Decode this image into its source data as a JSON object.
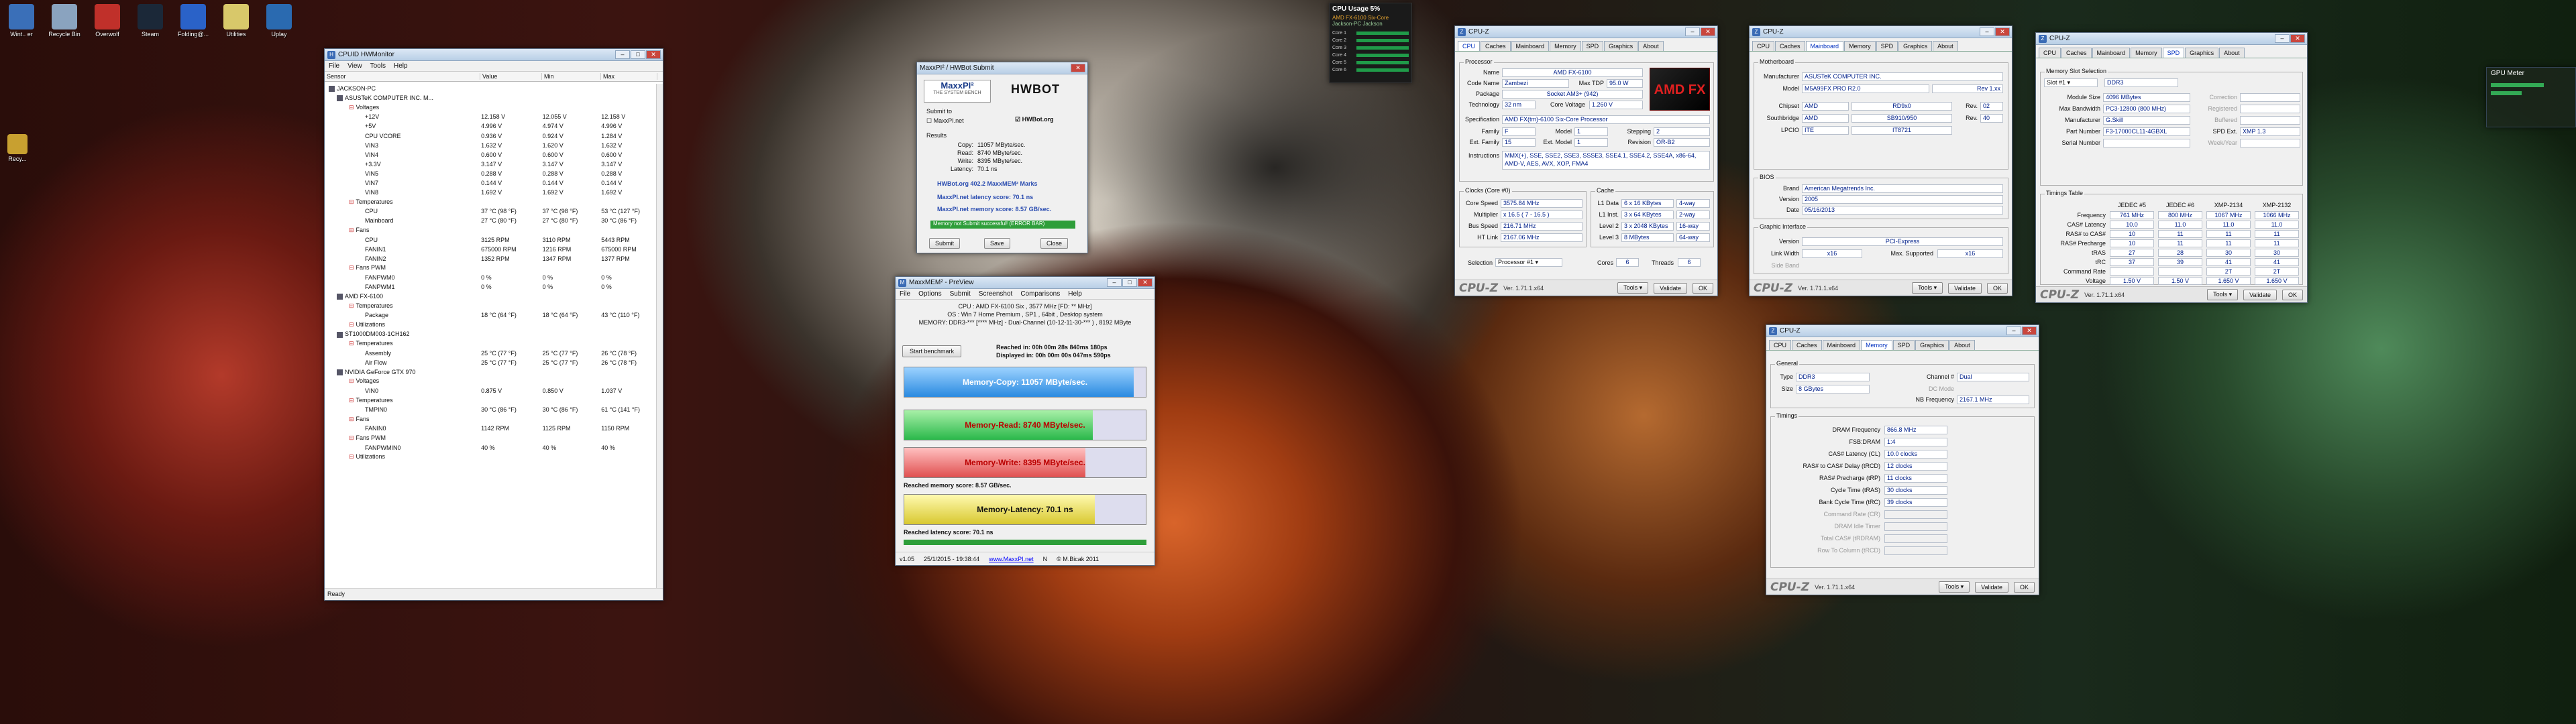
{
  "desktop_icons": [
    {
      "label": "Wint.. er",
      "color": "#3a6fb8"
    },
    {
      "label": "Recycle Bin",
      "color": "#8aa3bf"
    },
    {
      "label": "Overwolf",
      "color": "#c0302a"
    },
    {
      "label": "Steam",
      "color": "#1b2838"
    },
    {
      "label": "Folding@...",
      "color": "#2a62c8"
    },
    {
      "label": "Utilities",
      "color": "#d8c86a"
    },
    {
      "label": "Uplay",
      "color": "#2a6ab0"
    }
  ],
  "right_icon": {
    "label": "Recy..."
  },
  "hwmon": {
    "title": "CPUID HWMonitor",
    "menu": [
      "File",
      "View",
      "Tools",
      "Help"
    ],
    "cols": [
      "Sensor",
      "Value",
      "Min",
      "Max"
    ],
    "status": "Ready",
    "rows": [
      [
        "JACKSON-PC",
        "",
        "",
        ""
      ],
      [
        "ASUSTeK COMPUTER INC. M...",
        "",
        "",
        ""
      ],
      [
        "Voltages",
        "",
        "",
        ""
      ],
      [
        "+12V",
        "12.158 V",
        "12.055 V",
        "12.158 V"
      ],
      [
        "+5V",
        "4.996 V",
        "4.974 V",
        "4.996 V"
      ],
      [
        "CPU VCORE",
        "0.936 V",
        "0.924 V",
        "1.284 V"
      ],
      [
        "VIN3",
        "1.632 V",
        "1.620 V",
        "1.632 V"
      ],
      [
        "VIN4",
        "0.600 V",
        "0.600 V",
        "0.600 V"
      ],
      [
        "+3.3V",
        "3.147 V",
        "3.147 V",
        "3.147 V"
      ],
      [
        "VIN5",
        "0.288 V",
        "0.288 V",
        "0.288 V"
      ],
      [
        "VIN7",
        "0.144 V",
        "0.144 V",
        "0.144 V"
      ],
      [
        "VIN8",
        "1.692 V",
        "1.692 V",
        "1.692 V"
      ],
      [
        "Temperatures",
        "",
        "",
        ""
      ],
      [
        "CPU",
        "37 °C (98 °F)",
        "37 °C (98 °F)",
        "53 °C (127 °F)"
      ],
      [
        "Mainboard",
        "27 °C (80 °F)",
        "27 °C (80 °F)",
        "30 °C (86 °F)"
      ],
      [
        "Fans",
        "",
        "",
        ""
      ],
      [
        "CPU",
        "3125 RPM",
        "3110 RPM",
        "5443 RPM"
      ],
      [
        "FANIN1",
        "675000 RPM",
        "1216 RPM",
        "675000 RPM"
      ],
      [
        "FANIN2",
        "1352 RPM",
        "1347 RPM",
        "1377 RPM"
      ],
      [
        "Fans PWM",
        "",
        "",
        ""
      ],
      [
        "FANPWM0",
        "0 %",
        "0 %",
        "0 %"
      ],
      [
        "FANPWM1",
        "0 %",
        "0 %",
        "0 %"
      ],
      [
        "AMD FX-6100",
        "",
        "",
        ""
      ],
      [
        "Temperatures",
        "",
        "",
        ""
      ],
      [
        "Package",
        "18 °C (64 °F)",
        "18 °C (64 °F)",
        "43 °C (110 °F)"
      ],
      [
        "Utilizations",
        "",
        "",
        ""
      ],
      [
        "ST1000DM003-1CH162",
        "",
        "",
        ""
      ],
      [
        "Temperatures",
        "",
        "",
        ""
      ],
      [
        "Assembly",
        "25 °C (77 °F)",
        "25 °C (77 °F)",
        "26 °C (78 °F)"
      ],
      [
        "Air Flow",
        "25 °C (77 °F)",
        "25 °C (77 °F)",
        "26 °C (78 °F)"
      ],
      [
        "NVIDIA GeForce GTX 970",
        "",
        "",
        ""
      ],
      [
        "Voltages",
        "",
        "",
        ""
      ],
      [
        "VIN0",
        "0.875 V",
        "0.850 V",
        "1.037 V"
      ],
      [
        "Temperatures",
        "",
        "",
        ""
      ],
      [
        "TMPIN0",
        "30 °C (86 °F)",
        "30 °C (86 °F)",
        "61 °C (141 °F)"
      ],
      [
        "Fans",
        "",
        "",
        ""
      ],
      [
        "FANIN0",
        "1142 RPM",
        "1125 RPM",
        "1150 RPM"
      ],
      [
        "Fans PWM",
        "",
        "",
        ""
      ],
      [
        "FANPWMIN0",
        "40 %",
        "40 %",
        "40 %"
      ],
      [
        "Utilizations",
        "",
        "",
        ""
      ]
    ]
  },
  "submit": {
    "title": "MaxxPI² / HWBot Submit",
    "brand": "MaxxPI²",
    "brand_sub": "THE SYSTEM BENCH",
    "submit_to": "Submit to",
    "maxxpi_net": "MaxxPI.net",
    "hwbot": "HWBOT",
    "hwbot_org": "HWBot.org",
    "results": "Results",
    "lines": [
      [
        "Copy:",
        "11057 MByte/sec."
      ],
      [
        "Read:",
        "8740 MByte/sec."
      ],
      [
        "Write:",
        "8395 MByte/sec."
      ],
      [
        "Latency:",
        "70.1 ns"
      ]
    ],
    "marks": "HWBot.org 402.2 MaxxMEM² Marks",
    "latency": "MaxxPI.net latency score: 70.1 ns",
    "memory": "MaxxPI.net memory score:  8.57 GB/sec.",
    "status": "Memory not Submit successful!  (ERROR BAR)",
    "btn_submit": "Submit",
    "btn_save": "Save",
    "btn_close": "Close"
  },
  "maxxmem": {
    "title": "MaxxMEM² - PreView",
    "menu": [
      "File",
      "Options",
      "Submit",
      "Screenshot",
      "Comparisons",
      "Help"
    ],
    "cpu": "CPU : AMD FX-6100 Six , 3577 MHz  [FD: ** MHz]",
    "os": "OS : Win 7 Home Premium , SP1 , 64bit , Desktop system",
    "mem": "MEMORY: DDR3-*** [**** MHz] - Dual-Channel (10-12-11-30-*** ) , 8192 MByte",
    "start": "Start benchmark",
    "reached": "Reached in: 00h 00m 28s 840ms 180ps",
    "displayed": "Displayed in: 00h 00m 00s 047ms 590ps",
    "copy": "Memory-Copy: 11057 MByte/sec.",
    "read": "Memory-Read: 8740 MByte/sec.",
    "write": "Memory-Write: 8395 MByte/sec.",
    "mem_score": "Reached memory score: 8.57 GB/sec.",
    "latency": "Memory-Latency: 70.1 ns",
    "lat_score": "Reached latency score: 70.1 ns",
    "footer_ver": "v1.05",
    "footer_date": "25/1/2015 - 19:38:44",
    "footer_url": "www.MaxxPI.net",
    "footer_n": "N",
    "footer_copy": "© M.Bicak 2011",
    "fill": {
      "copy": 0.95,
      "read": 0.78,
      "write": 0.75,
      "latency": 0.79
    }
  },
  "cpuz_ver": "Ver. 1.71.1.x64",
  "tools": "Tools",
  "validate": "Validate",
  "ok": "OK",
  "cpuz1": {
    "title": "CPU-Z",
    "tabs": [
      "CPU",
      "Caches",
      "Mainboard",
      "Memory",
      "SPD",
      "Graphics",
      "About"
    ],
    "proc": "Processor",
    "fields": [
      [
        "Name",
        "AMD FX-6100"
      ],
      [
        "Code Name",
        "Zambezi"
      ],
      [
        "Package",
        "Socket AM3+ (942)"
      ],
      [
        "Technology",
        "32 nm"
      ],
      [
        "Specification",
        "AMD FX(tm)-6100 Six-Core Processor"
      ],
      [
        "Family",
        "F"
      ],
      [
        "Ext. Family",
        "15"
      ],
      [
        "Instructions",
        "MMX(+), SSE, SSE2, SSE3, SSSE3, SSE4.1, SSE4.2, SSE4A, x86-64, AMD-V, AES, AVX, XOP, FMA4"
      ]
    ],
    "max_tdp": "Max TDP",
    "tdp": "95.0 W",
    "core_voltage": "Core Voltage",
    "cv": "1.260 V",
    "model": "Model",
    "model_v": "1",
    "stepping": "Stepping",
    "stepping_v": "2",
    "ext_model": "Ext. Model",
    "ext_model_v": "1",
    "revision": "Revision",
    "revision_v": "OR-B2",
    "clocks_title": "Clocks (Core #0)",
    "clocks": [
      [
        "Core Speed",
        "3575.84 MHz"
      ],
      [
        "Multiplier",
        "x 16.5 ( 7 - 16.5 )"
      ],
      [
        "Bus Speed",
        "216.71 MHz"
      ],
      [
        "HT Link",
        "2167.06 MHz"
      ]
    ],
    "cache_title": "Cache",
    "cache": [
      [
        "L1 Data",
        "6 x 16 KBytes",
        "4-way"
      ],
      [
        "L1 Inst.",
        "3 x 64 KBytes",
        "2-way"
      ],
      [
        "Level 2",
        "3 x 2048 KBytes",
        "16-way"
      ],
      [
        "Level 3",
        "8 MBytes",
        "64-way"
      ]
    ],
    "selection": "Selection",
    "sel_v": "Processor #1",
    "cores": "Cores",
    "cores_v": "6",
    "threads": "Threads",
    "threads_v": "6",
    "logo": "AMD FX"
  },
  "cpuz2": {
    "title": "CPU-Z",
    "tabs": [
      "CPU",
      "Caches",
      "Mainboard",
      "Memory",
      "SPD",
      "Graphics",
      "About"
    ],
    "mb": "Motherboard",
    "fields": [
      [
        "Manufacturer",
        "ASUSTeK COMPUTER INC."
      ],
      [
        "Model",
        "M5A99FX PRO R2.0",
        "Rev 1.xx"
      ],
      [
        "Chipset",
        "AMD",
        "RD9x0",
        "Rev.",
        "02"
      ],
      [
        "Southbridge",
        "AMD",
        "SB910/950",
        "Rev.",
        "40"
      ],
      [
        "LPCIO",
        "ITE",
        "IT8721"
      ]
    ],
    "bios": "BIOS",
    "bios_fields": [
      [
        "Brand",
        "American Megatrends Inc."
      ],
      [
        "Version",
        "2005"
      ],
      [
        "Date",
        "05/16/2013"
      ]
    ],
    "gi": "Graphic Interface",
    "gi_fields": [
      [
        "Version",
        "PCI-Express"
      ],
      [
        "Link Width",
        "x16",
        "Max. Supported",
        "x16"
      ],
      [
        "Side Band",
        ""
      ]
    ]
  },
  "cpuz3": {
    "title": "CPU-Z",
    "tabs": [
      "CPU",
      "Caches",
      "Mainboard",
      "Memory",
      "SPD",
      "Graphics",
      "About"
    ],
    "slot_title": "Memory Slot Selection",
    "slot": "Slot #1",
    "type": "DDR3",
    "fields": [
      [
        "Module Size",
        "4096 MBytes",
        "Correction",
        ""
      ],
      [
        "Max Bandwidth",
        "PC3-12800 (800 MHz)",
        "Registered",
        ""
      ],
      [
        "Manufacturer",
        "G.Skill",
        "Buffered",
        ""
      ],
      [
        "Part Number",
        "F3-17000CL11-4GBXL",
        "SPD Ext.",
        "XMP 1.3"
      ],
      [
        "Serial Number",
        "",
        "Week/Year",
        ""
      ]
    ],
    "timings_title": "Timings Table",
    "timing_cols": [
      "JEDEC #5",
      "JEDEC #6",
      "XMP-2134",
      "XMP-2132"
    ],
    "timings": [
      [
        "Frequency",
        "761 MHz",
        "800 MHz",
        "1067 MHz",
        "1066 MHz"
      ],
      [
        "CAS# Latency",
        "10.0",
        "11.0",
        "11.0",
        "11.0"
      ],
      [
        "RAS# to CAS#",
        "10",
        "11",
        "11",
        "11"
      ],
      [
        "RAS# Precharge",
        "10",
        "11",
        "11",
        "11"
      ],
      [
        "tRAS",
        "27",
        "28",
        "30",
        "30"
      ],
      [
        "tRC",
        "37",
        "39",
        "41",
        "41"
      ],
      [
        "Command Rate",
        "",
        "",
        "2T",
        "2T"
      ],
      [
        "Voltage",
        "1.50 V",
        "1.50 V",
        "1.650 V",
        "1.650 V"
      ]
    ]
  },
  "cpuz4": {
    "title": "CPU-Z",
    "tabs": [
      "CPU",
      "Caches",
      "Mainboard",
      "Memory",
      "SPD",
      "Graphics",
      "About"
    ],
    "general": "General",
    "type": "Type",
    "type_v": "DDR3",
    "size": "Size",
    "size_v": "8 GBytes",
    "channel": "Channel #",
    "channel_v": "Dual",
    "dc_mode": "DC Mode",
    "nb_freq": "NB Frequency",
    "nb_freq_v": "2167.1 MHz",
    "timings_title": "Timings",
    "timings": [
      [
        "DRAM Frequency",
        "866.8 MHz"
      ],
      [
        "FSB:DRAM",
        "1:4"
      ],
      [
        "CAS# Latency (CL)",
        "10.0 clocks"
      ],
      [
        "RAS# to CAS# Delay (tRCD)",
        "12 clocks"
      ],
      [
        "RAS# Precharge (tRP)",
        "11 clocks"
      ],
      [
        "Cycle Time (tRAS)",
        "30 clocks"
      ],
      [
        "Bank Cycle Time (tRC)",
        "39 clocks"
      ],
      [
        "Command Rate (CR)",
        ""
      ],
      [
        "DRAM Idle Timer",
        ""
      ],
      [
        "Total CAS# (tRDRAM)",
        ""
      ],
      [
        "Row To Column (tRCD)",
        ""
      ]
    ]
  },
  "gadget": {
    "title": "CPU Usage 5%",
    "line1": "AMD FX-6100 Six-Core",
    "line2": "Jackson-PC Jackson",
    "cores": [
      "Core 1",
      "Core 2",
      "Core 3",
      "Core 4",
      "Core 5",
      "Core 6"
    ]
  },
  "gpu_gadget": {
    "title": "GPU Meter"
  }
}
